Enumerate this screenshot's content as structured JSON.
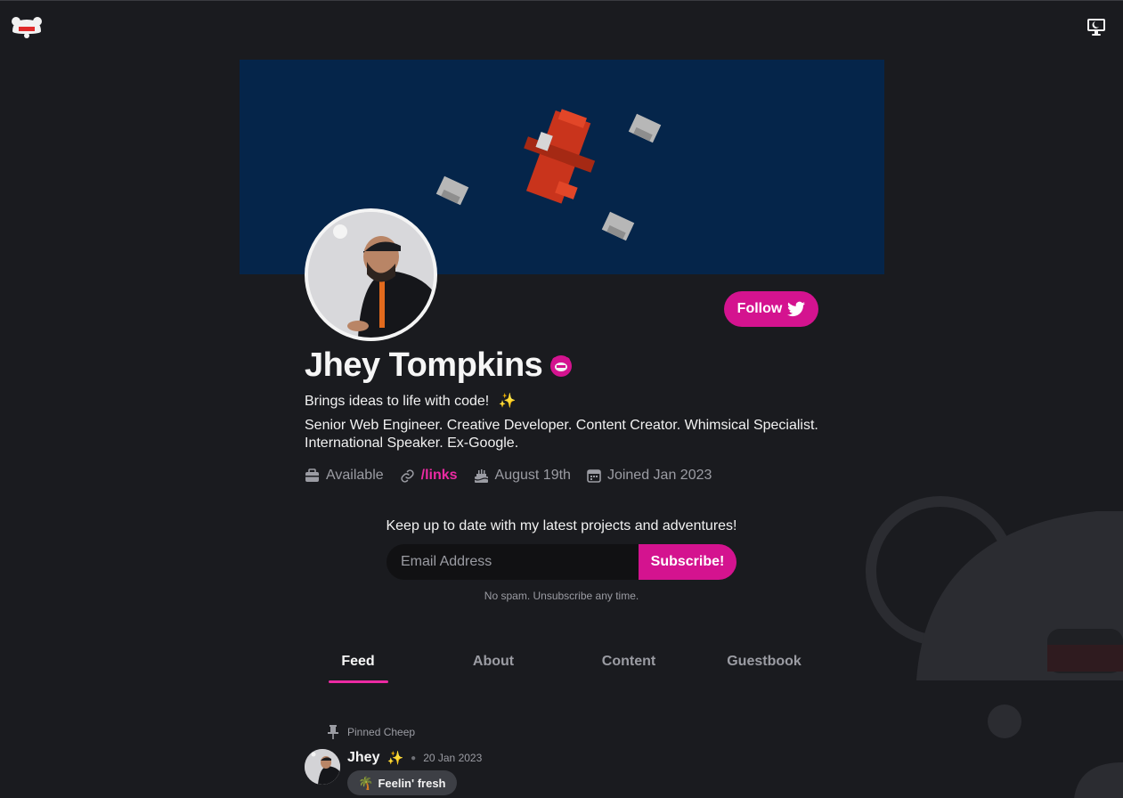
{
  "profile": {
    "name": "Jhey Tompkins",
    "tagline": "Brings ideas to life with code!",
    "bio": "Senior Web Engineer. Creative Developer. Content Creator. Whimsical Specialist. International Speaker. Ex-Google.",
    "follow_label": "Follow",
    "meta": {
      "availability": "Available",
      "link": "/links",
      "birthday": "August 19th",
      "joined": "Joined Jan 2023"
    }
  },
  "newsletter": {
    "title": "Keep up to date with my latest projects and adventures!",
    "placeholder": "Email Address",
    "button": "Subscribe!",
    "note": "No spam. Unsubscribe any time."
  },
  "tabs": [
    {
      "label": "Feed",
      "active": true
    },
    {
      "label": "About",
      "active": false
    },
    {
      "label": "Content",
      "active": false
    },
    {
      "label": "Guestbook",
      "active": false
    }
  ],
  "feed": {
    "pinned_label": "Pinned Cheep",
    "post": {
      "author": "Jhey",
      "date": "20 Jan 2023",
      "mood": "Feelin' fresh"
    }
  },
  "colors": {
    "accent": "#d4138f",
    "accent_text": "#ec2aa3",
    "background": "#1a1b1f",
    "banner": "#05254a"
  },
  "icons": [
    "bear-logo-icon",
    "theme-toggle-icon",
    "twitter-icon",
    "verified-badge-icon",
    "sparkles-icon",
    "briefcase-icon",
    "link-icon",
    "cake-icon",
    "calendar-icon",
    "pin-icon",
    "palm-tree-icon"
  ]
}
